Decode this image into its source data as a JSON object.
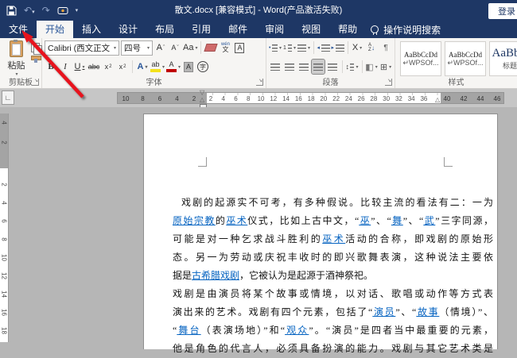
{
  "titlebar": {
    "title": "散文.docx [兼容模式] - Word(产品激活失败)",
    "signin": "登录"
  },
  "tabs": [
    {
      "label": "文件",
      "type": "file"
    },
    {
      "label": "开始",
      "active": true
    },
    {
      "label": "插入"
    },
    {
      "label": "设计"
    },
    {
      "label": "布局"
    },
    {
      "label": "引用"
    },
    {
      "label": "邮件"
    },
    {
      "label": "审阅"
    },
    {
      "label": "视图"
    },
    {
      "label": "帮助"
    }
  ],
  "search": {
    "label": "操作说明搜索"
  },
  "icons": {
    "undo": "↶",
    "redo": "↷",
    "qat_dropdown": "▾",
    "tab_selector": "∟",
    "bold": "B",
    "italic": "I",
    "underline": "U",
    "strikethrough": "abc",
    "subscript_base": "x",
    "subscript_small": "2",
    "superscript_base": "x",
    "superscript_small": "2",
    "grow_font": "A",
    "grow_mark": "ˆ",
    "shrink_font": "A",
    "shrink_mark": "ˇ",
    "change_case": "Aa",
    "phonetic_top": "wén",
    "phonetic_bottom": "文",
    "char_border": "A",
    "text_effects": "A",
    "highlight": "ab",
    "font_color": "A",
    "char_shading": "A",
    "enclose_char": "字",
    "asian_layout": "X",
    "sort_a": "A",
    "sort_z": "Z",
    "sort_arrow": "↓",
    "pilcrow": "¶",
    "line_spacing": "↕",
    "shading": "◧",
    "borders": "⊞",
    "outdent_arrow": "◂",
    "indent_arrow": "▸",
    "firstline_marker": "▽",
    "hanging_marker": "△",
    "right_indent_marker": "△"
  },
  "ribbon": {
    "clipboard": {
      "paste_label": "粘贴",
      "group_label": "剪贴板"
    },
    "font": {
      "font_name": "Calibri (西文正文",
      "font_size": "四号",
      "group_label": "字体"
    },
    "paragraph": {
      "group_label": "段落"
    },
    "styles": {
      "group_label": "样式",
      "chips": [
        {
          "sample": "AaBbCcDd",
          "label": "↵WPSOf...",
          "big": false
        },
        {
          "sample": "AaBbCcDd",
          "label": "↵WPSOf...",
          "big": false
        },
        {
          "sample": "AaBbC",
          "label": "标题",
          "big": true
        }
      ]
    }
  },
  "ruler": {
    "left_numbers": [
      "10",
      "8",
      "6",
      "4",
      "2"
    ],
    "center_numbers": [
      "2",
      "4",
      "6",
      "8",
      "10",
      "12",
      "14",
      "16",
      "18",
      "20",
      "22",
      "24",
      "26",
      "28",
      "30",
      "32",
      "34",
      "36"
    ],
    "right_numbers": [
      "40",
      "42",
      "44",
      "46"
    ]
  },
  "vruler": {
    "dark_numbers": [
      "4",
      "2"
    ],
    "white_numbers": [
      "2",
      "4",
      "6",
      "8",
      "10",
      "12",
      "14",
      "16",
      "18"
    ]
  },
  "document": {
    "lines": [
      {
        "justify": true,
        "indent": true,
        "runs": [
          {
            "t": "戏剧的起源实不可考，有多种假说。比较主流的看法有二：一为"
          }
        ]
      },
      {
        "justify": true,
        "runs": [
          {
            "t": "原始宗教",
            "link": true
          },
          {
            "t": "的"
          },
          {
            "t": "巫术",
            "link": true
          },
          {
            "t": "仪式，比如上古中文，“"
          },
          {
            "t": "巫",
            "link": true
          },
          {
            "t": "”、“"
          },
          {
            "t": "舞",
            "link": true
          },
          {
            "t": "”、“"
          },
          {
            "t": "武",
            "link": true
          },
          {
            "t": "”三字同源，"
          }
        ]
      },
      {
        "justify": true,
        "runs": [
          {
            "t": "可能是对一种乞求战斗胜利的"
          },
          {
            "t": "巫术",
            "link": true
          },
          {
            "t": "活动的合称，即戏剧的原始形"
          }
        ]
      },
      {
        "justify": true,
        "runs": [
          {
            "t": "态。另一为劳动或庆祝丰收时的即兴歌舞表演，这种说法主要依"
          }
        ]
      },
      {
        "justify": false,
        "runs": [
          {
            "t": "据是"
          },
          {
            "t": "古希腊戏剧",
            "link": true
          },
          {
            "t": "，它被认为是起源于酒神祭祀。"
          }
        ]
      },
      {
        "justify": true,
        "runs": [
          {
            "t": "戏剧是由演员将某个故事或情境，以对话、歌唱或动作等方式表"
          }
        ]
      },
      {
        "justify": true,
        "runs": [
          {
            "t": "演出来的艺术。戏剧有四个元素，包括了“"
          },
          {
            "t": "演员",
            "link": true
          },
          {
            "t": "”、“"
          },
          {
            "t": "故事",
            "link": true
          },
          {
            "t": "（情境）”、"
          }
        ]
      },
      {
        "justify": true,
        "runs": [
          {
            "t": "“"
          },
          {
            "t": "舞台",
            "link": true
          },
          {
            "t": "（表演场地）”和“"
          },
          {
            "t": "观众",
            "link": true
          },
          {
            "t": "”。“演员”是四者当中最重要的元素，"
          }
        ]
      },
      {
        "justify": true,
        "runs": [
          {
            "t": "他是角色的代言人，必须具备扮演的能力。戏剧与其它艺术类是"
          }
        ]
      }
    ]
  },
  "colors": {
    "titlebar": "#1e3765",
    "active_tab_text": "#2b579a",
    "link": "#0563c1",
    "arrow": "#e8131d",
    "highlight_yellow": "#f3e11c",
    "font_color_red": "#c00000"
  }
}
